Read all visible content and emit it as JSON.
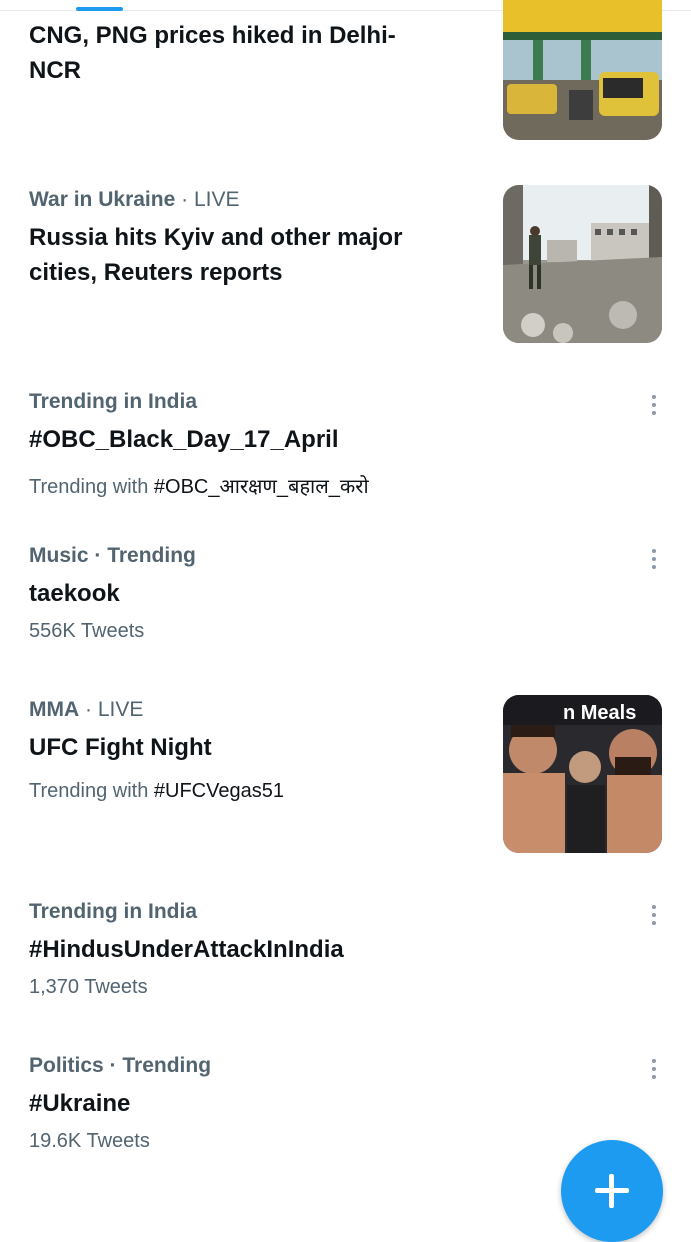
{
  "colors": {
    "accent": "#1d9bf0",
    "text_primary": "#0f1419",
    "text_secondary": "#536471"
  },
  "feed": {
    "items": [
      {
        "headline": "CNG, PNG prices hiked in Delhi-NCR",
        "thumbnail": "gas-station-photo"
      },
      {
        "category": "War in Ukraine",
        "status": "LIVE",
        "headline": "Russia hits Kyiv and other major cities, Reuters reports",
        "thumbnail": "ruined-city-photo"
      },
      {
        "category": "Trending in India",
        "headline": "#OBC_Black_Day_17_April",
        "trending_with_label": "Trending with",
        "trending_with_tag": "#OBC_आरक्षण_बहाल_करो",
        "menu_icon": "more-vertical-icon"
      },
      {
        "category": "Music",
        "separator": " · ",
        "status": "Trending",
        "headline": "taekook",
        "tweet_count": "556K Tweets",
        "menu_icon": "more-vertical-icon"
      },
      {
        "category": "MMA",
        "status": "LIVE",
        "headline": "UFC Fight Night",
        "trending_with_label": "Trending with",
        "trending_with_tag": "#UFCVegas51",
        "thumbnail": "fighters-faceoff-photo",
        "thumbnail_text": "n Meals"
      },
      {
        "category": "Trending in India",
        "headline": "#HindusUnderAttackInIndia",
        "tweet_count": "1,370 Tweets",
        "menu_icon": "more-vertical-icon"
      },
      {
        "category": "Politics",
        "separator": " · ",
        "status": "Trending",
        "headline": "#Ukraine",
        "tweet_count": "19.6K Tweets",
        "menu_icon": "more-vertical-icon"
      }
    ]
  },
  "compose_button": {
    "icon": "plus-icon"
  }
}
